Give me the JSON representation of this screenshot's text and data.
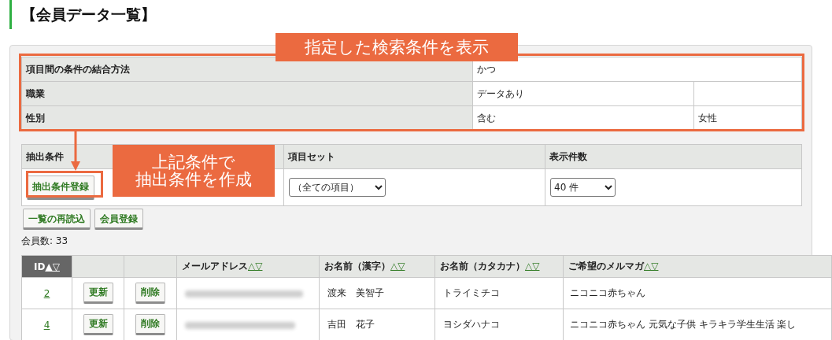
{
  "page_title": "【会員データ一覧】",
  "annotations": [
    {
      "text": "指定した検索条件を表示"
    },
    {
      "lines": [
        "上記条件で",
        "抽出条件を作成"
      ]
    }
  ],
  "conditions": [
    {
      "kind": "span",
      "label": "項目間の条件の結合方法",
      "value": "かつ"
    },
    {
      "kind": "split",
      "label": "職業",
      "value": "データあり"
    },
    {
      "kind": "split",
      "label": "性別",
      "value": "含む",
      "extra": "女性"
    }
  ],
  "extraction": {
    "headers": [
      "抽出条件",
      "項目セット",
      "表示件数"
    ],
    "register_button": "抽出条件登録",
    "item_set": "（全ての項目）",
    "page_size": "40 件"
  },
  "buttons": [
    "一覧の再読込",
    "会員登録"
  ],
  "member_count": "会員数: 33",
  "members": {
    "columns": [
      {
        "label": "ID",
        "sort": "▲▽",
        "selected": true
      },
      {
        "selected": false
      },
      {
        "selected": false
      },
      {
        "label": "メールアドレス",
        "sort": "△▽",
        "selected": false
      },
      {
        "label": "お名前（漢字）",
        "sort": "△▽",
        "selected": false
      },
      {
        "label": "お名前（カタカナ）",
        "sort": "△▽",
        "selected": false
      },
      {
        "label": "ご希望のメルマガ",
        "sort": "△▽",
        "selected": false
      }
    ],
    "rows": [
      {
        "id": "2",
        "update": "更新",
        "delete": "削除",
        "name_kanji": "渡来　美智子",
        "name_kana": "トライミチコ",
        "newsletter": "ニコニコ赤ちゃん"
      },
      {
        "id": "4",
        "update": "更新",
        "delete": "削除",
        "name_kanji": "吉田　花子",
        "name_kana": "ヨシダハナコ",
        "newsletter": "ニコニコ赤ちゃん 元気な子供 キラキラ学生生活 楽し"
      }
    ]
  }
}
